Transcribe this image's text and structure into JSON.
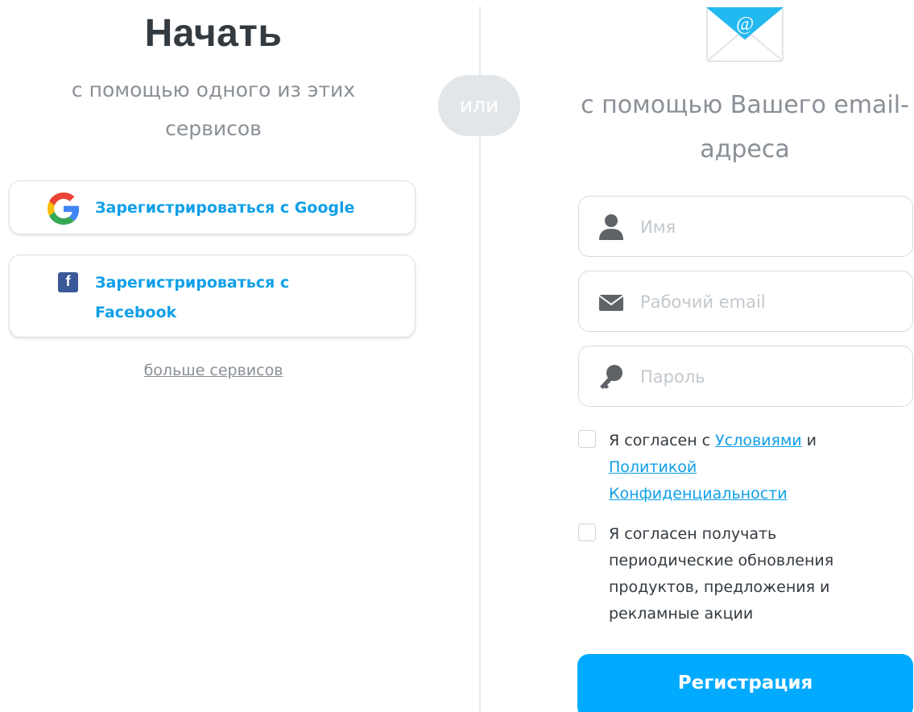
{
  "left": {
    "title": "Начать",
    "subtitle": "с помощью одного из этих сервисов",
    "google_button": "Зарегистрироваться с Google",
    "facebook_button": "Зарегистрироваться с Facebook",
    "more_services": "больше сервисов"
  },
  "divider": {
    "or": "или"
  },
  "right": {
    "subtitle": "с помощью Вашего email-адреса",
    "fields": {
      "name": {
        "placeholder": "Имя",
        "value": ""
      },
      "email": {
        "placeholder": "Рабочий email",
        "value": ""
      },
      "password": {
        "placeholder": "Пароль",
        "value": ""
      }
    },
    "terms": {
      "prefix": "Я согласен с ",
      "terms_link": "Условиями",
      "middle": " и ",
      "privacy_link": "Политикой Конфиденциальности"
    },
    "newsletter": "Я согласен получать периодические обновления продуктов, предложения и рекламные акции",
    "register_button": "Регистрация"
  },
  "icons": {
    "google": "google-logo-icon",
    "facebook": "facebook-logo-icon",
    "envelope": "email-envelope-icon",
    "user": "user-icon",
    "mail": "mail-icon",
    "key": "key-icon"
  },
  "colors": {
    "accent": "#00aaff",
    "link": "#0f9fe8",
    "facebook": "#3b5998",
    "muted_text": "#8a9096",
    "placeholder": "#c3c8cd"
  }
}
